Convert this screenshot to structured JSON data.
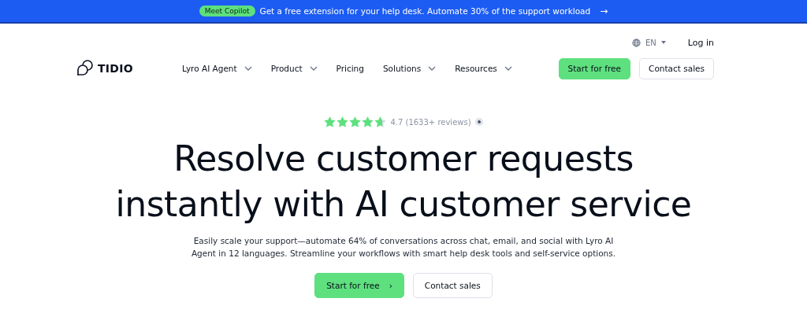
{
  "banner": {
    "badge": "Meet Copilot",
    "text": "Get a free extension for your help desk. Automate 30% of the support workload",
    "arrow": "→"
  },
  "utility": {
    "language": "EN",
    "login": "Log in"
  },
  "logo": "TIDIO",
  "nav": [
    {
      "label": "Lyro AI Agent",
      "has_menu": true
    },
    {
      "label": "Product",
      "has_menu": true
    },
    {
      "label": "Pricing",
      "has_menu": false
    },
    {
      "label": "Solutions",
      "has_menu": true
    },
    {
      "label": "Resources",
      "has_menu": true
    }
  ],
  "header_buttons": [
    {
      "label": "Start for free",
      "kind": "primary"
    },
    {
      "label": "Contact sales",
      "kind": "secondary"
    }
  ],
  "rating": {
    "stars": 4.7,
    "text": "4.7 (1633+ reviews)"
  },
  "hero": {
    "title_lines": [
      "Resolve customer requests",
      "instantly with AI customer service"
    ],
    "lines": [
      "Easily scale your support—automate 64% of conversations across chat, email, and social with Lyro AI",
      "Agent in 12 languages. Streamline your workflows with smart help desk tools and self-service options."
    ],
    "buttons": [
      {
        "label": "Start for free",
        "kind": "primary",
        "chevron": "›"
      },
      {
        "label": "Contact sales",
        "kind": "secondary"
      }
    ]
  }
}
